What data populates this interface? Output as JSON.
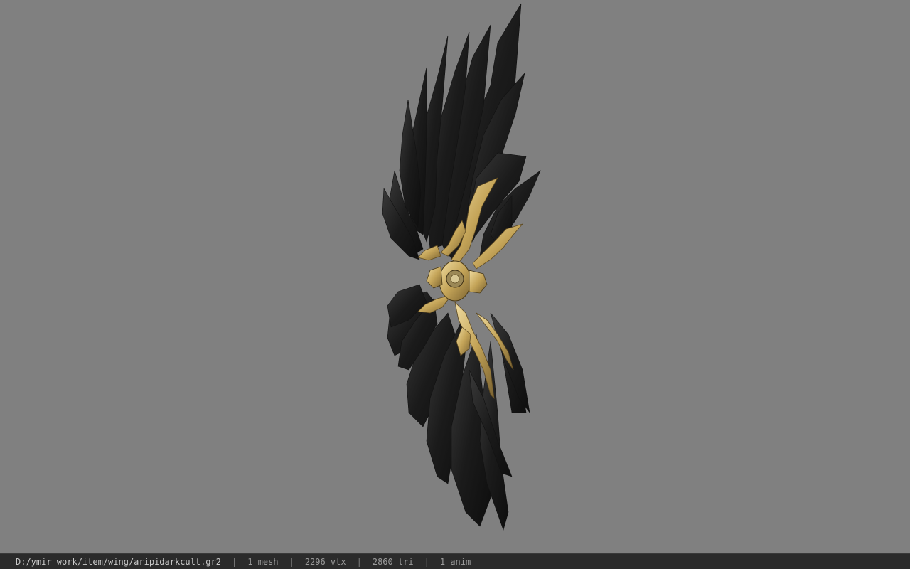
{
  "viewport": {
    "background_color": "#808080",
    "model_name": "wing-model-icon"
  },
  "status_bar": {
    "file_path": "D:/ymir work/item/wing/aripidarkcult.gr2",
    "separator": "|",
    "mesh_count": "1 mesh",
    "vertex_count": "2296 vtx",
    "triangle_count": "2860 tri",
    "anim_count": "1 anim"
  },
  "colors": {
    "feather": "#1a1a1a",
    "feather_edge": "#2e2e2e",
    "gold": "#b8994a",
    "gold_light": "#e0c98a"
  }
}
